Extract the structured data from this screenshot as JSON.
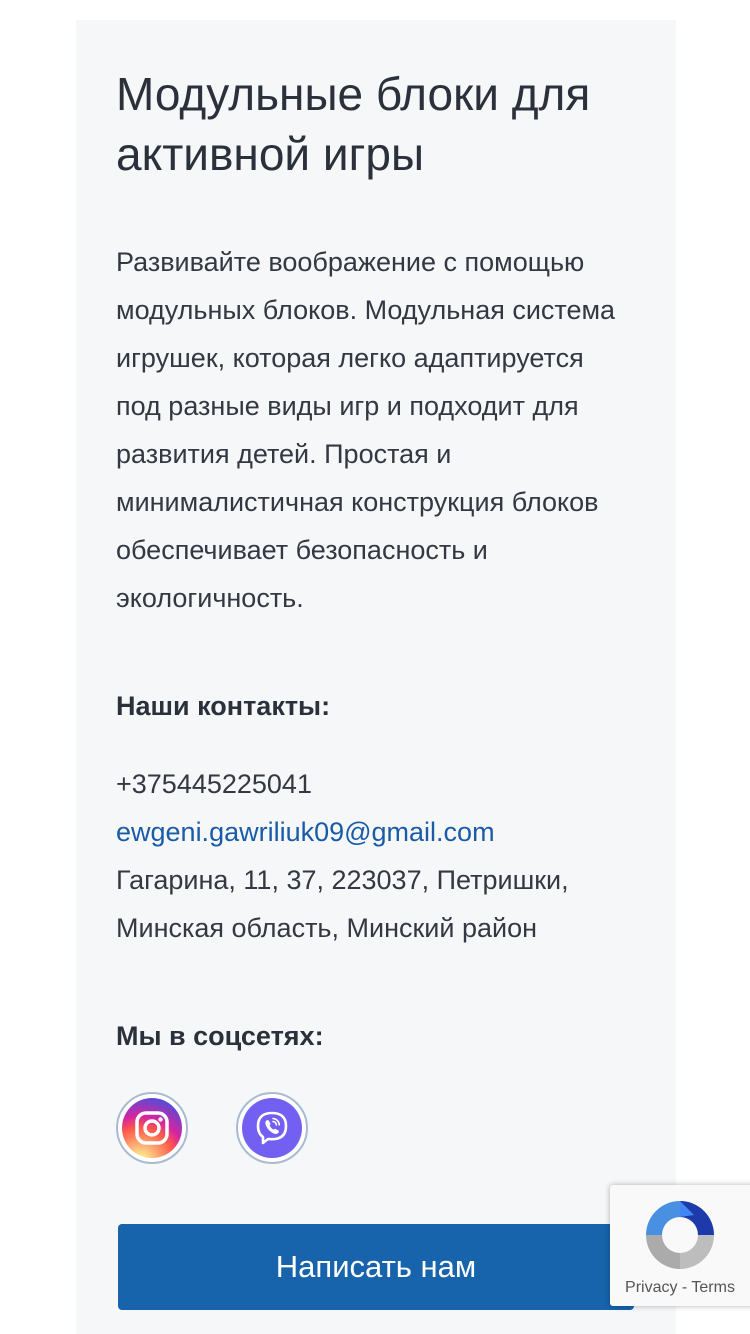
{
  "card": {
    "title": "Модульные блоки для активной игры",
    "description": "Развивайте воображение с помощью модульных блоков. Модульная система игрушек, которая легко адаптируется под разные виды игр и подходит для развития детей. Простая и минималистичная конструкция блоков обеспечивает безопасность и экологичность."
  },
  "contacts": {
    "heading": "Наши контакты:",
    "phone": "+375445225041",
    "email": "ewgeni.gawriliuk09@gmail.com",
    "address_line1": "Гагарина, 11, 37, 223037, Петришки,",
    "address_line2": "Минская область, Минский район"
  },
  "social": {
    "heading": "Мы в соцсетях:",
    "items": [
      {
        "icon": "instagram-icon"
      },
      {
        "icon": "viber-icon"
      }
    ]
  },
  "cta": {
    "label": "Написать нам"
  },
  "recaptcha": {
    "privacy": "Privacy",
    "separator": "-",
    "terms": "Terms"
  },
  "colors": {
    "accent": "#1763ac",
    "link": "#1a5ba8",
    "card_bg": "#f6f7f9",
    "viber": "#7360f2"
  }
}
